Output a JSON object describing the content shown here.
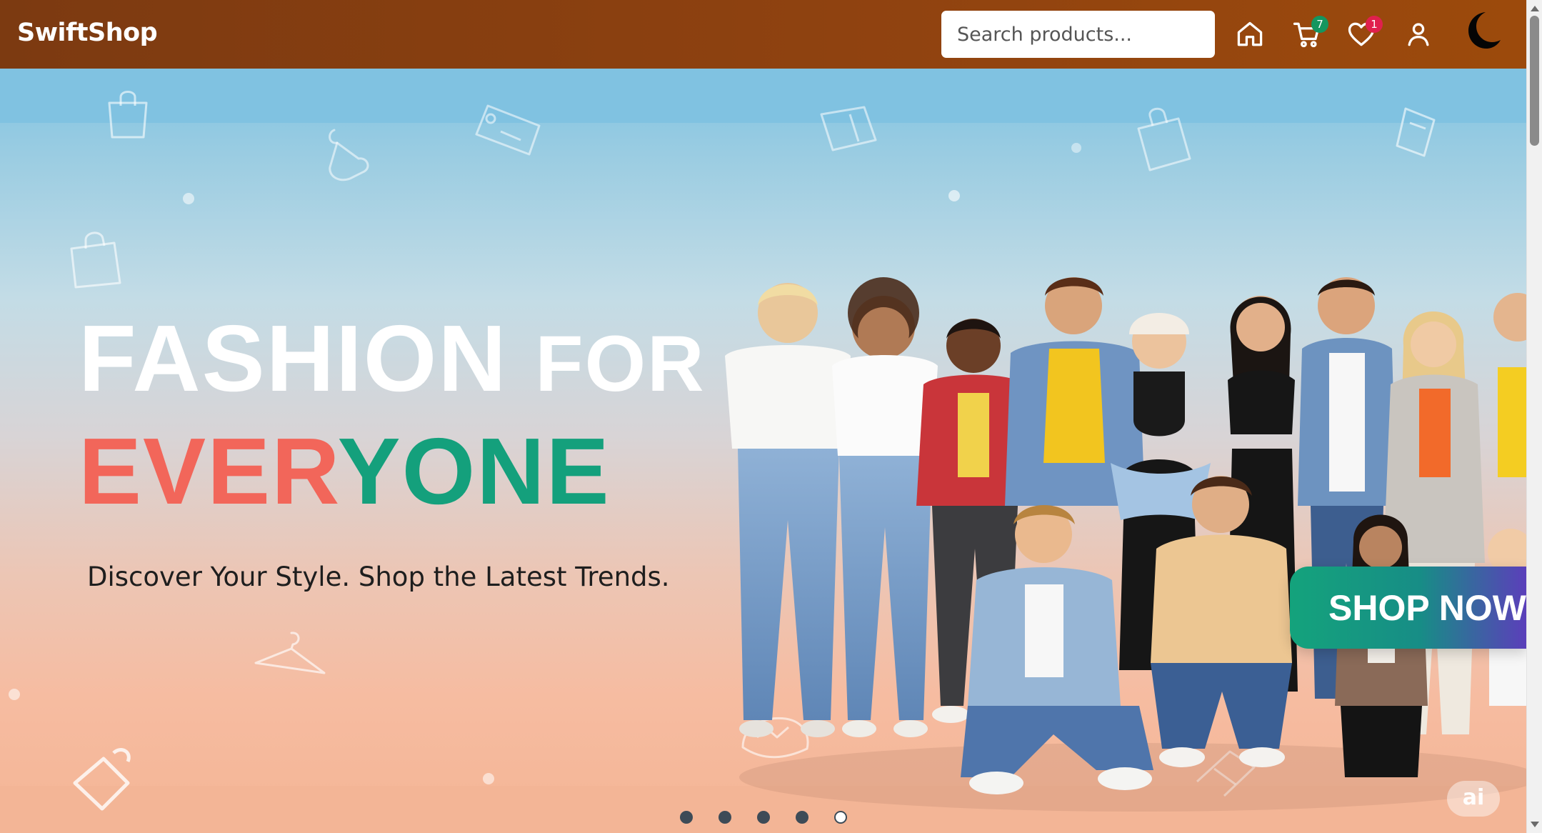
{
  "header": {
    "brand": "SwiftShop",
    "search_placeholder": "Search products...",
    "icons": [
      {
        "name": "home-icon"
      },
      {
        "name": "cart-icon",
        "badge": "7",
        "badge_color": "#14965f"
      },
      {
        "name": "heart-icon",
        "badge": "1",
        "badge_color": "#e0204d"
      },
      {
        "name": "user-icon"
      },
      {
        "name": "moon-icon"
      }
    ]
  },
  "hero": {
    "headline_line1_word1": "FASHION",
    "headline_line1_word2": "FOR",
    "headline_line2_part1": "EVER",
    "headline_line2_part2": "YONE",
    "tagline": "Discover Your Style. Shop the Latest Trends.",
    "cta_label": "SHOP NOW",
    "slides_count": 5,
    "active_slide": 5,
    "watermark": "ai"
  },
  "colors": {
    "header_brown": "#8f4210",
    "coral": "#f2665a",
    "teal": "#14a07c",
    "purple": "#5b3fba",
    "sky": "#80c2e1",
    "peach": "#f4b595"
  }
}
